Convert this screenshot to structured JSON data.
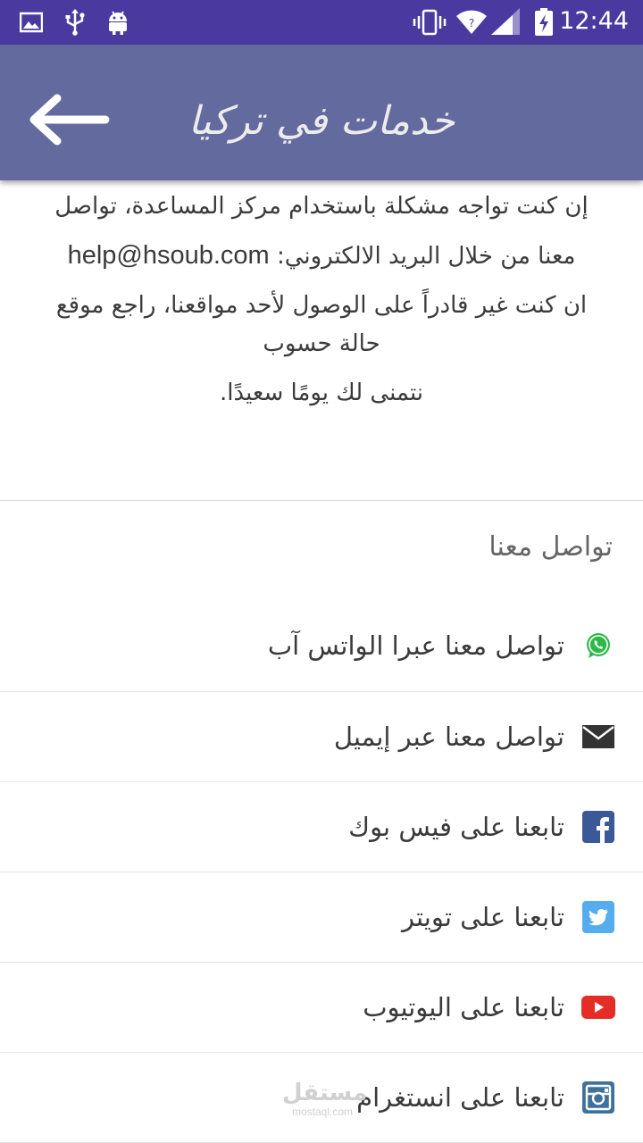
{
  "status_bar": {
    "time": "12:44",
    "icons_left": [
      "image-icon",
      "usb-icon",
      "android-icon"
    ],
    "icons_right": [
      "vibrate-icon",
      "wifi-icon",
      "signal-icon",
      "battery-charging-icon"
    ],
    "background": "#4a3aa0"
  },
  "app_bar": {
    "title": "خدمات في تركيا",
    "back_icon": "arrow-left-icon",
    "background": "#636a9e"
  },
  "info": {
    "line1": "إن كنت تواجه مشكلة باستخدام مركز المساعدة، تواصل",
    "line2_prefix": "معنا من خلال البريد الالكتروني:",
    "email": "help@hsoub.com",
    "line3": "ان كنت غير قادراً على الوصول لأحد مواقعنا، راجع موقع",
    "line4": "حالة حسوب",
    "line5": "نتمنى لك يومًا سعيدًا."
  },
  "contact": {
    "header": "تواصل معنا",
    "items": [
      {
        "label": "تواصل معنا عبرا الواتس آب",
        "icon": "whatsapp-icon",
        "color": "#2fb84a"
      },
      {
        "label": "تواصل معنا عبر إيميل",
        "icon": "email-icon",
        "color": "#333333"
      },
      {
        "label": "تابعنا على فيس بوك",
        "icon": "facebook-icon",
        "color": "#3b5998"
      },
      {
        "label": "تابعنا على تويتر",
        "icon": "twitter-icon",
        "color": "#55acee"
      },
      {
        "label": "تابعنا على اليوتيوب",
        "icon": "youtube-icon",
        "color": "#e52d27"
      },
      {
        "label": "تابعنا على انستغرام",
        "icon": "instagram-icon",
        "color": "#3f729b"
      }
    ]
  },
  "watermark": {
    "main": "مستقل",
    "sub": "mostaql.com"
  }
}
